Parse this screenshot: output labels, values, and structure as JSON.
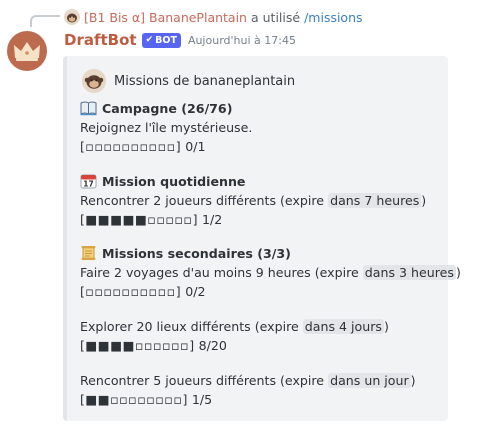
{
  "reply": {
    "name": "[B1 Bis α] BananePlantain",
    "used_text": "a utilisé",
    "command": "/missions"
  },
  "author": {
    "username": "DraftBot",
    "bot_tag": "BOT",
    "timestamp": "Aujourd'hui à 17:45"
  },
  "embed": {
    "title": "Missions de bananeplantain",
    "campaign": {
      "title": "Campagne (26/76)",
      "description": "Rejoignez l'île mystérieuse.",
      "bar": "[▫▫▫▫▫▫▫▫▫▫]",
      "progress": "0/1",
      "progress_fraction": 0
    },
    "daily": {
      "title": "Mission quotidienne",
      "description": "Rencontrer 2 joueurs différents (expire",
      "expires": "dans 7 heures",
      "close": ")",
      "bar": "[■■■■■▫▫▫▫▫]",
      "progress": "1/2",
      "progress_fraction": 0.5
    },
    "secondary": {
      "title": "Missions secondaires (3/3)",
      "missions": [
        {
          "description": "Faire 2 voyages d'au moins 9 heures (expire",
          "expires": "dans 3 heures",
          "close": ")",
          "bar": "[▫▫▫▫▫▫▫▫▫▫]",
          "progress": "0/2",
          "progress_fraction": 0
        },
        {
          "description": "Explorer 20 lieux différents (expire",
          "expires": "dans 4 jours",
          "close": ")",
          "bar": "[■■■■▫▫▫▫▫▫]",
          "progress": "8/20",
          "progress_fraction": 0.4
        },
        {
          "description": "Rencontrer 5 joueurs différents (expire",
          "expires": "dans un jour",
          "close": ")",
          "bar": "[■■▫▫▫▫▫▫▫▫]",
          "progress": "1/5",
          "progress_fraction": 0.2
        }
      ]
    }
  },
  "icons": {
    "reply_avatar": "monkey-avatar-icon",
    "bot_avatar": "crown-icon",
    "campaign": "open-book-icon",
    "daily": "calendar-icon",
    "secondary": "scroll-icon",
    "verified": "check-icon"
  },
  "colors": {
    "username": "#bd5d40",
    "reply_name": "#c96a5a",
    "command": "#3b82c4",
    "bot_tag": "#5865f2",
    "embed_bg": "#f2f3f5",
    "embed_border": "#e3e5e8",
    "avatar_bg": "#bd6b4f",
    "highlight_bg": "#e3e5e8"
  }
}
